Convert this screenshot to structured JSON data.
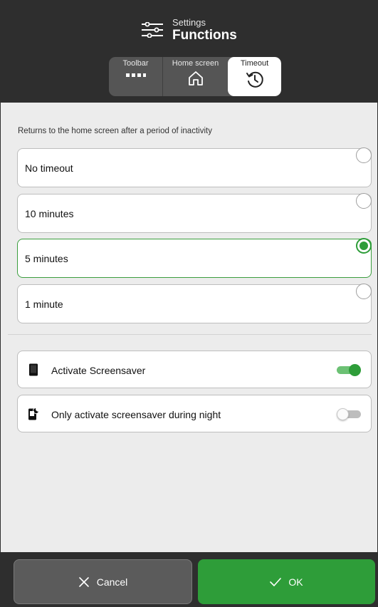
{
  "header": {
    "subtitle": "Settings",
    "title": "Functions",
    "icon": "sliders-icon"
  },
  "tabs": [
    {
      "label": "Toolbar",
      "icon": "toolbar-dots-icon",
      "active": false
    },
    {
      "label": "Home screen",
      "icon": "home-icon",
      "active": false
    },
    {
      "label": "Timeout",
      "icon": "history-clock-icon",
      "active": true
    }
  ],
  "description": "Returns to the home screen after a period of inactivity",
  "options": [
    {
      "label": "No timeout",
      "selected": false
    },
    {
      "label": "10 minutes",
      "selected": false
    },
    {
      "label": "5 minutes",
      "selected": true
    },
    {
      "label": "1 minute",
      "selected": false
    }
  ],
  "toggles": [
    {
      "label": "Activate Screensaver",
      "icon": "tablet-icon",
      "on": true
    },
    {
      "label": "Only activate screensaver during night",
      "icon": "tablet-night-icon",
      "on": false
    }
  ],
  "footer": {
    "cancel_label": "Cancel",
    "ok_label": "OK"
  },
  "colors": {
    "header_bg": "#2e2e2e",
    "accent_green": "#2e9d39",
    "content_bg": "#ececec"
  }
}
